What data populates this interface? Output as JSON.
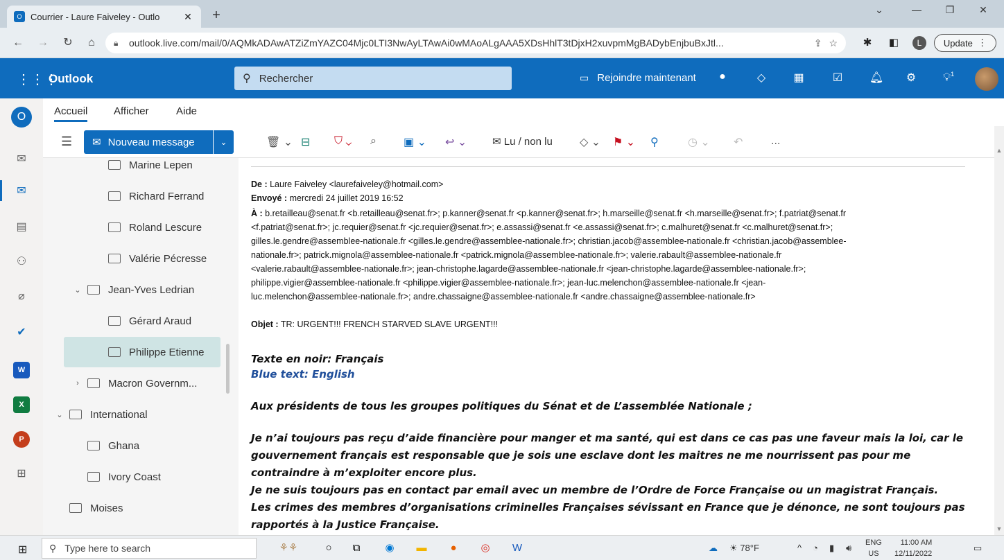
{
  "browser": {
    "tab_title": "Courrier - Laure Faiveley - Outlo",
    "url": "outlook.live.com/mail/0/AQMkADAwATZiZmYAZC04Mjc0LTI3NwAyLTAwAi0wMAoALgAAA5XDsHhlT3tDjxH2xuvpmMgBADybEnjbuBxJtl...",
    "update_label": "Update",
    "profile_initial": "L"
  },
  "outlook": {
    "brand": "Outlook",
    "search_placeholder": "Rechercher",
    "join_now": "Rejoindre maintenant",
    "notification_badge": "1"
  },
  "ribbon": {
    "tabs": [
      "Accueil",
      "Afficher",
      "Aide"
    ],
    "new_message": "Nouveau message",
    "read_unread": "Lu / non lu",
    "more": "..."
  },
  "folders": [
    {
      "label": "Marine Lepen",
      "indent": 2
    },
    {
      "label": "Richard Ferrand",
      "indent": 2
    },
    {
      "label": "Roland Lescure",
      "indent": 2
    },
    {
      "label": "Valérie Pécresse",
      "indent": 2
    },
    {
      "label": "Jean-Yves Ledrian",
      "indent": 1,
      "expanded": true
    },
    {
      "label": "Gérard Araud",
      "indent": 2
    },
    {
      "label": "Philippe Etienne",
      "indent": 2,
      "selected": true
    },
    {
      "label": "Macron Governm...",
      "indent": 1,
      "expanded": false
    },
    {
      "label": "International",
      "indent": 0,
      "expanded": true
    },
    {
      "label": "Ghana",
      "indent": 1
    },
    {
      "label": "Ivory Coast",
      "indent": 1
    },
    {
      "label": "Moises",
      "indent": 0
    }
  ],
  "email": {
    "from_label": "De :",
    "from": "Laure Faiveley <laurefaiveley@hotmail.com>",
    "sent_label": "Envoyé :",
    "sent": "mercredi 24 juillet 2019 16:52",
    "to_label": "À :",
    "to_lines": [
      "b.retailleau@senat.fr <b.retailleau@senat.fr>; p.kanner@senat.fr <p.kanner@senat.fr>; h.marseille@senat.fr <h.marseille@senat.fr>; f.patriat@senat.fr",
      "<f.patriat@senat.fr>; jc.requier@senat.fr <jc.requier@senat.fr>; e.assassi@senat.fr <e.assassi@senat.fr>; c.malhuret@senat.fr <c.malhuret@senat.fr>;",
      "gilles.le.gendre@assemblee-nationale.fr <gilles.le.gendre@assemblee-nationale.fr>; christian.jacob@assemblee-nationale.fr <christian.jacob@assemblee-",
      "nationale.fr>; patrick.mignola@assemblee-nationale.fr <patrick.mignola@assemblee-nationale.fr>; valerie.rabault@assemblee-nationale.fr",
      "<valerie.rabault@assemblee-nationale.fr>; jean-christophe.lagarde@assemblee-nationale.fr <jean-christophe.lagarde@assemblee-nationale.fr>;",
      "philippe.vigier@assemblee-nationale.fr <philippe.vigier@assemblee-nationale.fr>; jean-luc.melenchon@assemblee-nationale.fr <jean-",
      "luc.melenchon@assemblee-nationale.fr>; andre.chassaigne@assemblee-nationale.fr <andre.chassaigne@assemblee-nationale.fr>"
    ],
    "subject_label": "Objet :",
    "subject": "TR: URGENT!!! FRENCH STARVED SLAVE URGENT!!!",
    "body": {
      "legend_fr": "Texte en noir: Français",
      "legend_en": "Blue text: English",
      "salutation": "Aux présidents de tous les groupes politiques du Sénat et de L’assemblée Nationale ;",
      "p1": [
        "Je n’ai toujours pas reçu d’aide financière pour manger et ma santé, qui est dans ce cas pas une faveur mais la loi, car le",
        "gouvernement français est responsable que je sois une esclave dont les maitres ne me nourrissent pas pour me",
        "contraindre à m’exploiter encore plus.",
        "Je ne suis toujours pas en contact par email avec un membre de l’Ordre de Force Française ou un magistrat Français.",
        "Les crimes des membres d’organisations criminelles Françaises sévissant en France que je dénonce, ne sont toujours pas",
        "rapportés à la Justice Française."
      ]
    }
  },
  "taskbar": {
    "search_placeholder": "Type here to search",
    "weather": "78°F",
    "lang": "ENG",
    "region": "US",
    "time": "11:00 AM",
    "date": "12/11/2022"
  }
}
